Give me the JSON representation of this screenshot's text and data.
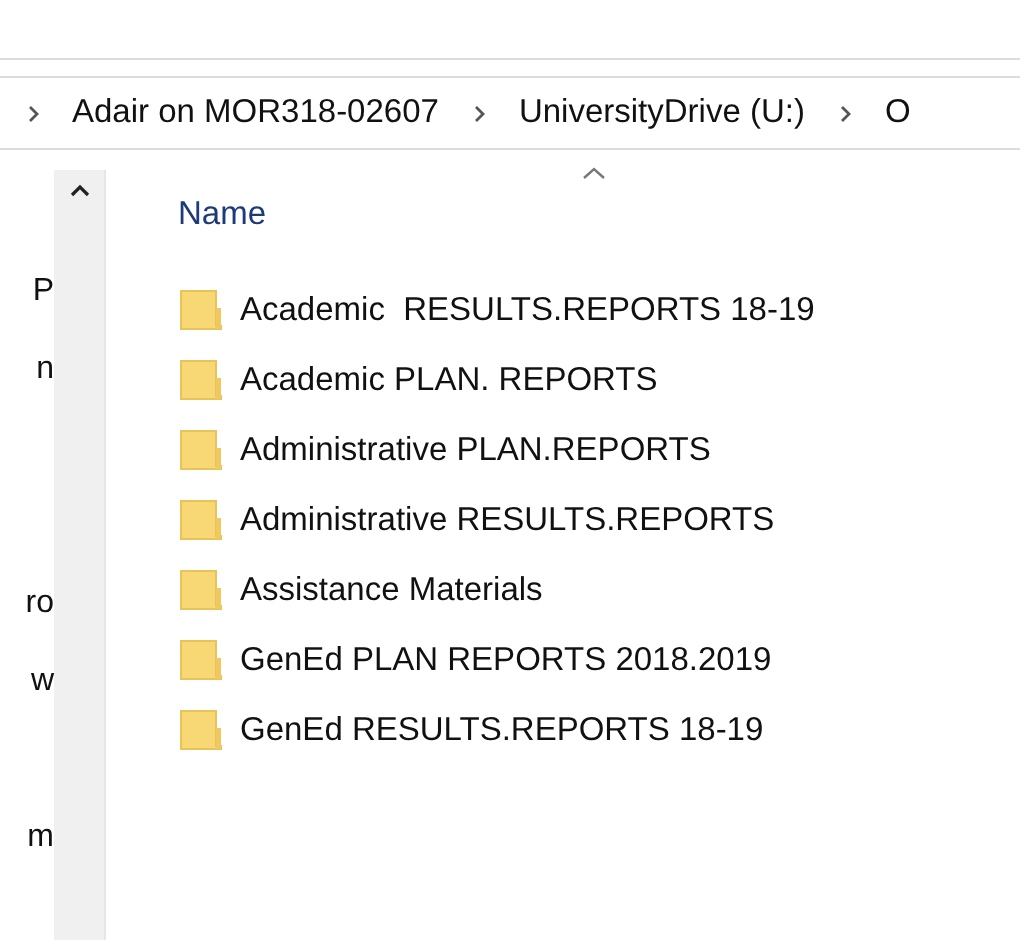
{
  "breadcrumb": [
    "Adair on MOR318-02607",
    "UniversityDrive (U:)",
    "O"
  ],
  "navigation_pane": [
    "P",
    "n",
    "ro",
    "w",
    "m"
  ],
  "column_header": {
    "label": "Name",
    "sorted_ascending": true
  },
  "files": [
    {
      "name": "Academic  RESULTS.REPORTS 18-19",
      "kind": "folder"
    },
    {
      "name": "Academic PLAN. REPORTS",
      "kind": "folder"
    },
    {
      "name": "Administrative PLAN.REPORTS",
      "kind": "folder"
    },
    {
      "name": "Administrative RESULTS.REPORTS",
      "kind": "folder"
    },
    {
      "name": "Assistance Materials",
      "kind": "folder"
    },
    {
      "name": "GenEd PLAN REPORTS 2018.2019",
      "kind": "folder"
    },
    {
      "name": "GenEd RESULTS.REPORTS 18-19",
      "kind": "folder"
    }
  ]
}
